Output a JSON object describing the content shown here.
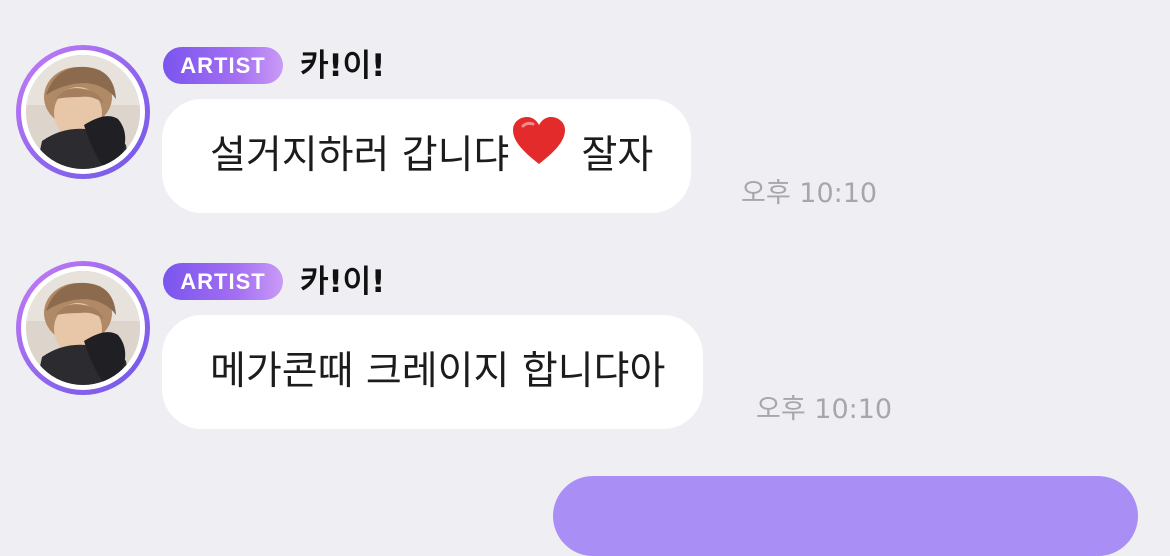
{
  "messages": [
    {
      "badge": "ARTIST",
      "sender": "카!이!",
      "text": "설거지하러 갑니댜",
      "emoji": "heart-emoji",
      "text_after": "잘자",
      "time": "오후 10:10"
    },
    {
      "badge": "ARTIST",
      "sender": "카!이!",
      "text": "메가콘때 크레이지 합니댜아",
      "time": "오후 10:10"
    }
  ],
  "colors": {
    "background": "#efeff3",
    "bubble": "#ffffff",
    "badge_start": "#7a55ee",
    "badge_end": "#c99af6",
    "avatar_ring": "#8f66ee",
    "timestamp": "#a7a7ab",
    "outgoing_bubble": "#a98ef5"
  }
}
